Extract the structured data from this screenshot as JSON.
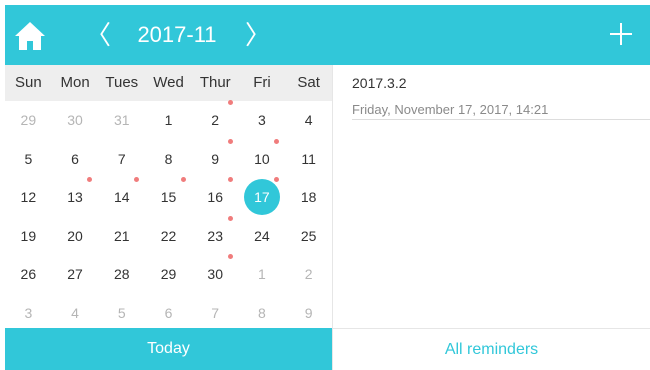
{
  "colors": {
    "accent": "#31c7d9",
    "dot": "#f07c7c"
  },
  "header": {
    "home_icon": "home-icon",
    "prev_label": "〈",
    "month_label": "2017-11",
    "next_label": "〉",
    "add_icon": "plus-icon"
  },
  "calendar": {
    "weekdays": [
      "Sun",
      "Mon",
      "Tues",
      "Wed",
      "Thur",
      "Fri",
      "Sat"
    ],
    "weeks": [
      [
        {
          "d": "29",
          "muted": true
        },
        {
          "d": "30",
          "muted": true
        },
        {
          "d": "31",
          "muted": true
        },
        {
          "d": "1"
        },
        {
          "d": "2",
          "dot": true
        },
        {
          "d": "3"
        },
        {
          "d": "4"
        }
      ],
      [
        {
          "d": "5"
        },
        {
          "d": "6"
        },
        {
          "d": "7"
        },
        {
          "d": "8"
        },
        {
          "d": "9",
          "dot": true
        },
        {
          "d": "10",
          "dot": true
        },
        {
          "d": "11"
        }
      ],
      [
        {
          "d": "12"
        },
        {
          "d": "13",
          "dot": true
        },
        {
          "d": "14",
          "dot": true
        },
        {
          "d": "15",
          "dot": true
        },
        {
          "d": "16",
          "dot": true
        },
        {
          "d": "17",
          "selected": true,
          "dot": true
        },
        {
          "d": "18"
        }
      ],
      [
        {
          "d": "19"
        },
        {
          "d": "20"
        },
        {
          "d": "21"
        },
        {
          "d": "22"
        },
        {
          "d": "23",
          "dot": true
        },
        {
          "d": "24"
        },
        {
          "d": "25"
        }
      ],
      [
        {
          "d": "26"
        },
        {
          "d": "27"
        },
        {
          "d": "28"
        },
        {
          "d": "29"
        },
        {
          "d": "30",
          "dot": true
        },
        {
          "d": "1",
          "muted": true
        },
        {
          "d": "2",
          "muted": true
        }
      ],
      [
        {
          "d": "3",
          "muted": true
        },
        {
          "d": "4",
          "muted": true
        },
        {
          "d": "5",
          "muted": true
        },
        {
          "d": "6",
          "muted": true
        },
        {
          "d": "7",
          "muted": true
        },
        {
          "d": "8",
          "muted": true
        },
        {
          "d": "9",
          "muted": true
        }
      ]
    ]
  },
  "reminder": {
    "title": "2017.3.2",
    "datetime": "Friday, November 17, 2017, 14:21"
  },
  "footer": {
    "today_label": "Today",
    "all_label": "All reminders"
  }
}
